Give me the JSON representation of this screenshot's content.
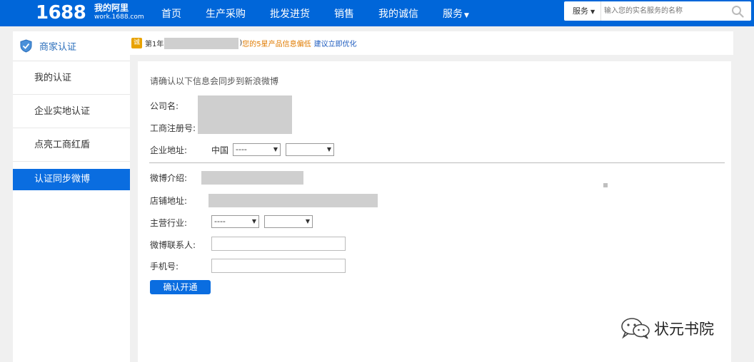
{
  "header": {
    "logo": "1688",
    "mywork_title": "我的阿里",
    "mywork_sub": "work.1688.com",
    "nav": [
      "首页",
      "生产采购",
      "批发进货",
      "销售",
      "我的诚信",
      "服务"
    ],
    "search_category": "服务",
    "search_placeholder": "输入您的实名服务的名称"
  },
  "sidebar": {
    "title": "商家认证",
    "items": [
      "我的认证",
      "企业实地认证",
      "点亮工商红盾",
      "认证同步微博"
    ],
    "active_index": 3
  },
  "notice": {
    "badge": "诚",
    "prefix": "第1年",
    "suffix": ")",
    "warning": "您的5星产品信息偏低",
    "link": "建议立即优化"
  },
  "form": {
    "intro": "请确认以下信息会同步到新浪微博",
    "company_label": "公司名:",
    "reg_label": "工商注册号:",
    "address_label": "企业地址:",
    "country": "中国",
    "address_select1": "----",
    "address_select2": "",
    "weibo_intro_label": "微博介绍:",
    "shop_address_label": "店铺地址:",
    "industry_label": "主营行业:",
    "industry_select1": "----",
    "industry_select2": "",
    "contact_label": "微博联系人:",
    "contact_value": "",
    "phone_label": "手机号:",
    "phone_value": "",
    "submit": "确认开通"
  },
  "watermark": {
    "text": "状元书院",
    "icon": "wechat-icon"
  },
  "colors": {
    "topbar": "#0066d9",
    "active": "#0a6de0",
    "warning": "#e07b00",
    "link": "#1d5bbf"
  }
}
